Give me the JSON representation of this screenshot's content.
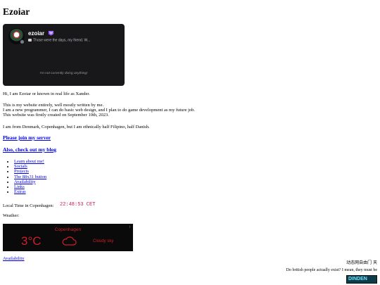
{
  "title": "Ezoiar",
  "discord_card": {
    "username": "ezoiar",
    "custom_status": "Those were the days, my friend. W...",
    "activity": "I'm not currently doing anything!",
    "badge_icon": "nitro-badge-icon",
    "status_color": "#747f8d"
  },
  "intro": "Hi, I am Ezoiar or known in real life as Xander.",
  "about": [
    "This is my website entirely, well mostly written by me.",
    "I am a new programmer, I can do basic web design, and I plan to do game development as my future job.",
    "This website was firstly created on September 10th, 2023."
  ],
  "origin": "I am from Denmark, Copenhagen, but I am ethnically half Filipino, half Danish.",
  "server_link": "Please join my server",
  "blog_link": "Also, check out my blog",
  "nav_links": [
    "Learn about me!",
    "Socials",
    "Projects",
    "The 88x31 button",
    "Availability",
    "Links",
    "Extras"
  ],
  "time_label": "Local Time in Copenhagen:",
  "time_value": "22:48:53 CET",
  "weather_label": "Weather:",
  "weather": {
    "city": "Copenhagen",
    "temperature": "3°C",
    "description": "Cloudy sky",
    "icon": "cloud-icon",
    "info_mark": "i",
    "accent": "#d11f2b"
  },
  "availability_link": "Availability",
  "side_text_1": "动态网自由门 天",
  "side_text_2": "Do british people actually exist? I mean, they must be",
  "button_text": "DINDEN"
}
